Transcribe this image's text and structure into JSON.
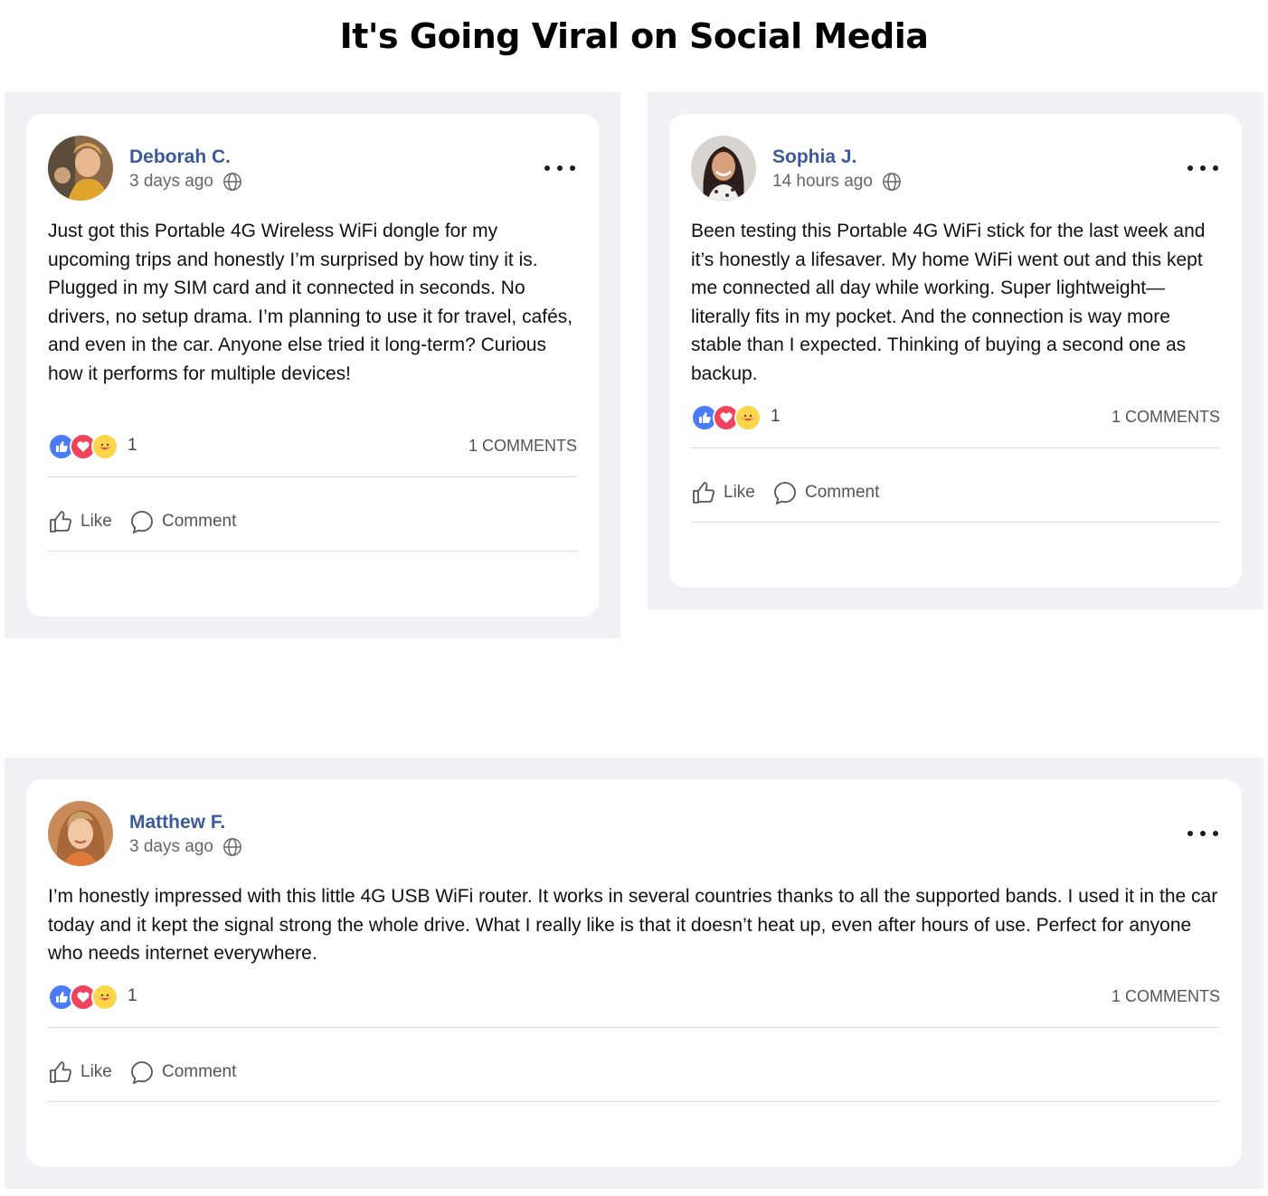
{
  "page": {
    "title": "It's Going Viral on Social Media"
  },
  "posts": [
    {
      "author": "Deborah C.",
      "time": "3 days ago",
      "text": "Just got this Portable 4G Wireless WiFi dongle for my upcoming trips and honestly I’m surprised by how tiny it is. Plugged in my SIM card and it connected in seconds. No drivers, no setup drama. I’m planning to use it for travel, cafés, and even in the car. Anyone else tried it long-term? Curious how it performs for multiple devices!",
      "reaction_count": "1",
      "comments_label": "1 COMMENTS",
      "like_label": "Like",
      "comment_label": "Comment",
      "avatar_icon": "user-avatar-photo"
    },
    {
      "author": "Sophia J.",
      "time": "14 hours ago",
      "text": "Been testing this Portable 4G WiFi stick for the last week and it’s honestly a lifesaver. My home WiFi went out and this kept me connected all day while working. Super lightweight—literally fits in my pocket. And the connection is way more stable than I expected. Thinking of buying a second one as backup.",
      "reaction_count": "1",
      "comments_label": "1 COMMENTS",
      "like_label": "Like",
      "comment_label": "Comment",
      "avatar_icon": "user-avatar-photo"
    },
    {
      "author": "Matthew F.",
      "time": "3 days ago",
      "text": "I’m honestly impressed with this little 4G USB WiFi router. It works in several countries thanks to all the supported bands. I used it in the car today and it kept the signal strong the whole drive. What I really like is that it doesn’t heat up, even after hours of use. Perfect for anyone who needs internet everywhere.",
      "reaction_count": "1",
      "comments_label": "1 COMMENTS",
      "like_label": "Like",
      "comment_label": "Comment",
      "avatar_icon": "user-avatar-photo"
    }
  ],
  "colors": {
    "name": "#3b5a99",
    "panel_bg": "#f0f1f4",
    "like_reaction": "#4a7cf5",
    "love_reaction": "#f0445d",
    "haha_reaction": "#fbd54a"
  },
  "icons": [
    "globe-icon",
    "more-options-icon",
    "like-reaction-icon",
    "love-reaction-icon",
    "haha-reaction-icon",
    "thumbs-up-icon",
    "comment-bubble-icon"
  ]
}
